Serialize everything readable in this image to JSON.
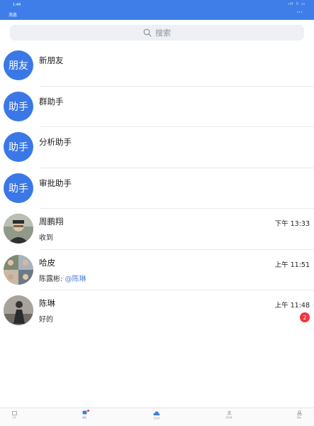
{
  "status_bar": {
    "time": "1:44",
    "icons": "ıll ⌔ ▭"
  },
  "nav": {
    "title": "消息",
    "more": "···"
  },
  "search": {
    "placeholder": "搜索"
  },
  "system_items": [
    {
      "avatar_text": "朋友",
      "name": "新朋友"
    },
    {
      "avatar_text": "助手",
      "name": "群助手"
    },
    {
      "avatar_text": "助手",
      "name": "分析助手"
    },
    {
      "avatar_text": "助手",
      "name": "审批助手"
    }
  ],
  "conversations": [
    {
      "name": "周鹏翔",
      "preview": "收到",
      "time": "下午 13:33"
    },
    {
      "name": "哈皮",
      "preview_prefix": "陈露彬: ",
      "preview_mention": "@陈琳",
      "time": "上午 11:51"
    },
    {
      "name": "陈琳",
      "preview": "好的",
      "time": "上午 11:48",
      "badge": "2"
    }
  ],
  "tabbar": {
    "tabs": [
      {
        "label": "工作"
      },
      {
        "label": "消息"
      },
      {
        "label": "云空间"
      },
      {
        "label": "通讯录"
      },
      {
        "label": "我的"
      }
    ]
  },
  "colors": {
    "brand": "#3f7ee8",
    "badge": "#f2333a",
    "mention": "#4a7fd6"
  }
}
